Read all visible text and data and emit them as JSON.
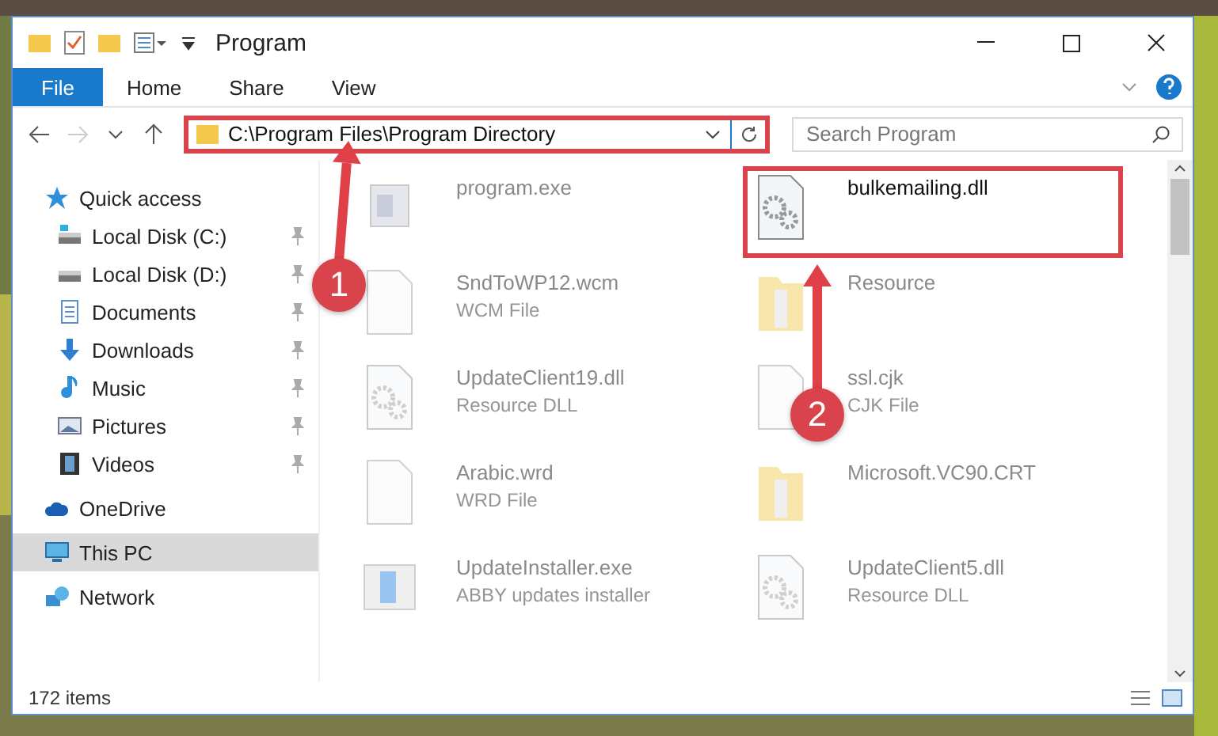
{
  "window": {
    "title": "Program"
  },
  "ribbon_tabs": [
    {
      "label": "File",
      "kind": "file"
    },
    {
      "label": "Home",
      "kind": "tab"
    },
    {
      "label": "Share",
      "kind": "tab"
    },
    {
      "label": "View",
      "kind": "tab"
    }
  ],
  "address": {
    "path": "C:\\Program Files\\Program Directory",
    "highlighted": true
  },
  "search": {
    "placeholder": "Search Program"
  },
  "sidebar": {
    "items": [
      {
        "label": "Quick access",
        "kind": "quick",
        "selected": false,
        "children": [
          {
            "label": "Local Disk (C:)",
            "kind": "diskc",
            "pinned": true,
            "selected": false
          },
          {
            "label": "Local Disk (D:)",
            "kind": "disk",
            "pinned": true,
            "selected": false
          },
          {
            "label": "Documents",
            "kind": "documents",
            "pinned": true,
            "selected": false
          },
          {
            "label": "Downloads",
            "kind": "downloads",
            "pinned": true,
            "selected": false
          },
          {
            "label": "Music",
            "kind": "music",
            "pinned": true,
            "selected": false
          },
          {
            "label": "Pictures",
            "kind": "pictures",
            "pinned": true,
            "selected": false
          },
          {
            "label": "Videos",
            "kind": "videos",
            "pinned": true,
            "selected": false
          }
        ]
      },
      {
        "label": "OneDrive",
        "kind": "cloud",
        "selected": false
      },
      {
        "label": "This PC",
        "kind": "pc",
        "selected": true
      },
      {
        "label": "Network",
        "kind": "network",
        "selected": false
      }
    ]
  },
  "files": [
    {
      "name": "program.exe",
      "kind": "exe",
      "blurred": true,
      "highlighted": false
    },
    {
      "name": "bulkemailing.dll",
      "kind": "dll",
      "blurred": false,
      "highlighted": true
    },
    {
      "name": "SndToWP12.wcm",
      "type": "WCM File",
      "kind": "file",
      "blurred": true,
      "highlighted": false
    },
    {
      "name": "Resource",
      "kind": "folder",
      "blurred": true,
      "highlighted": false
    },
    {
      "name": "UpdateClient19.dll",
      "type": "Resource DLL",
      "kind": "dll",
      "blurred": true,
      "highlighted": false
    },
    {
      "name": "ssl.cjk",
      "type": "CJK File",
      "kind": "file",
      "blurred": true,
      "highlighted": false
    },
    {
      "name": "Arabic.wrd",
      "type": "WRD File",
      "kind": "file",
      "blurred": true,
      "highlighted": false
    },
    {
      "name": "Microsoft.VC90.CRT",
      "kind": "folder",
      "blurred": true,
      "highlighted": false
    },
    {
      "name": "UpdateInstaller.exe",
      "type": "ABBY updates installer",
      "kind": "installer",
      "blurred": true,
      "highlighted": false
    },
    {
      "name": "UpdateClient5.dll",
      "type": "Resource DLL",
      "kind": "dll",
      "blurred": true,
      "highlighted": false
    }
  ],
  "status_bar": {
    "count": "172 items"
  },
  "annotations": [
    {
      "label": "1",
      "kind": "address"
    },
    {
      "label": "2",
      "kind": "file"
    }
  ]
}
